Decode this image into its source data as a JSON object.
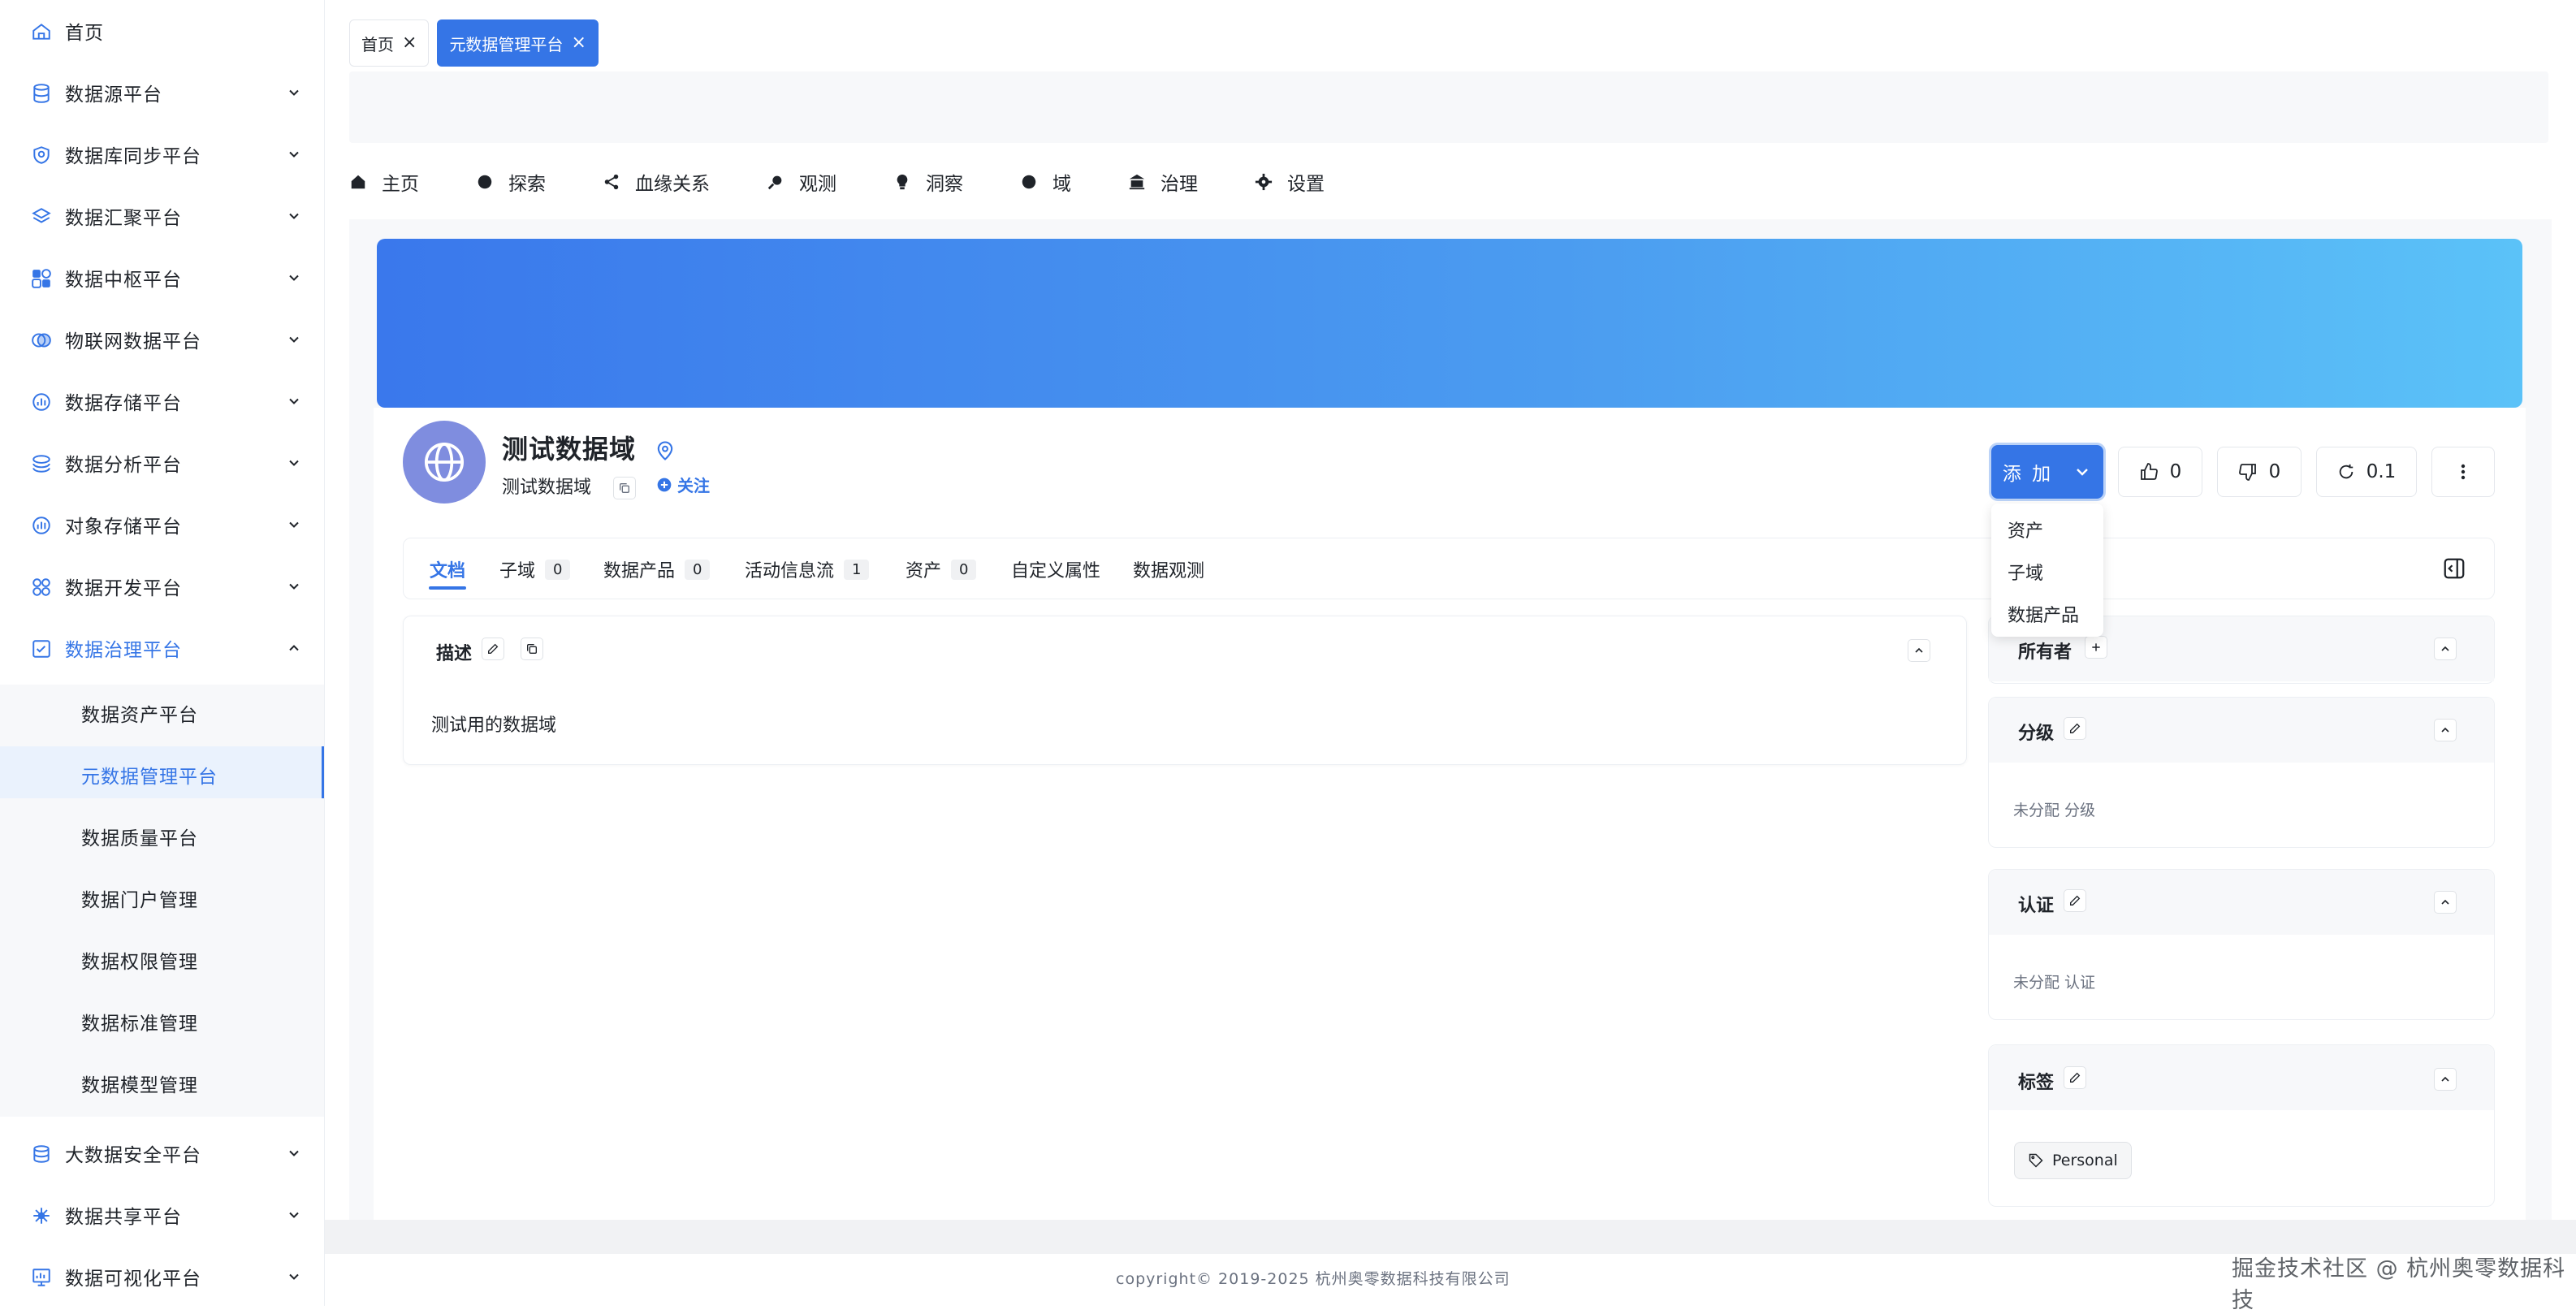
{
  "sidebar": {
    "items": [
      {
        "label": "首页",
        "icon": "home-icon"
      },
      {
        "label": "数据源平台",
        "icon": "database-icon"
      },
      {
        "label": "数据库同步平台",
        "icon": "sync-icon"
      },
      {
        "label": "数据汇聚平台",
        "icon": "layers-icon"
      },
      {
        "label": "数据中枢平台",
        "icon": "grid-icon"
      },
      {
        "label": "物联网数据平台",
        "icon": "iot-icon"
      },
      {
        "label": "数据存储平台",
        "icon": "storage-icon"
      },
      {
        "label": "数据分析平台",
        "icon": "analysis-icon"
      },
      {
        "label": "对象存储平台",
        "icon": "object-storage-icon"
      },
      {
        "label": "数据开发平台",
        "icon": "develop-icon"
      },
      {
        "label": "数据治理平台",
        "icon": "governance-icon"
      },
      {
        "label": "大数据安全平台",
        "icon": "security-icon"
      },
      {
        "label": "数据共享平台",
        "icon": "share-icon"
      },
      {
        "label": "数据可视化平台",
        "icon": "visualization-icon"
      }
    ],
    "sub_items": [
      "数据资产平台",
      "元数据管理平台",
      "数据质量平台",
      "数据门户管理",
      "数据权限管理",
      "数据标准管理",
      "数据模型管理"
    ]
  },
  "page_tabs": [
    {
      "label": "首页"
    },
    {
      "label": "元数据管理平台"
    }
  ],
  "nav": [
    "主页",
    "探索",
    "血缘关系",
    "观测",
    "洞察",
    "域",
    "治理",
    "设置"
  ],
  "entity": {
    "title": "测试数据域",
    "subtitle": "测试数据域",
    "follow": "关注"
  },
  "actions": {
    "add": "添 加",
    "likes": "0",
    "dislikes": "0",
    "version": "0.1"
  },
  "add_menu": [
    "资产",
    "子域",
    "数据产品"
  ],
  "tabs": [
    {
      "label": "文档",
      "count": null
    },
    {
      "label": "子域",
      "count": "0"
    },
    {
      "label": "数据产品",
      "count": "0"
    },
    {
      "label": "活动信息流",
      "count": "1"
    },
    {
      "label": "资产",
      "count": "0"
    },
    {
      "label": "自定义属性",
      "count": null
    },
    {
      "label": "数据观测",
      "count": null
    }
  ],
  "description": {
    "title": "描述",
    "text": "测试用的数据域"
  },
  "right_panel": {
    "owner_title": "所有者",
    "tier_title": "分级",
    "tier_empty": "未分配 分级",
    "cert_title": "认证",
    "cert_empty": "未分配 认证",
    "tags_title": "标签",
    "tag": "Personal"
  },
  "footer": {
    "copyright": "copyright© 2019-2025 杭州奥零数据科技有限公司",
    "watermark": "掘金技术社区 @ 杭州奥零数据科技"
  },
  "colors": {
    "accent": "#3575e6"
  }
}
